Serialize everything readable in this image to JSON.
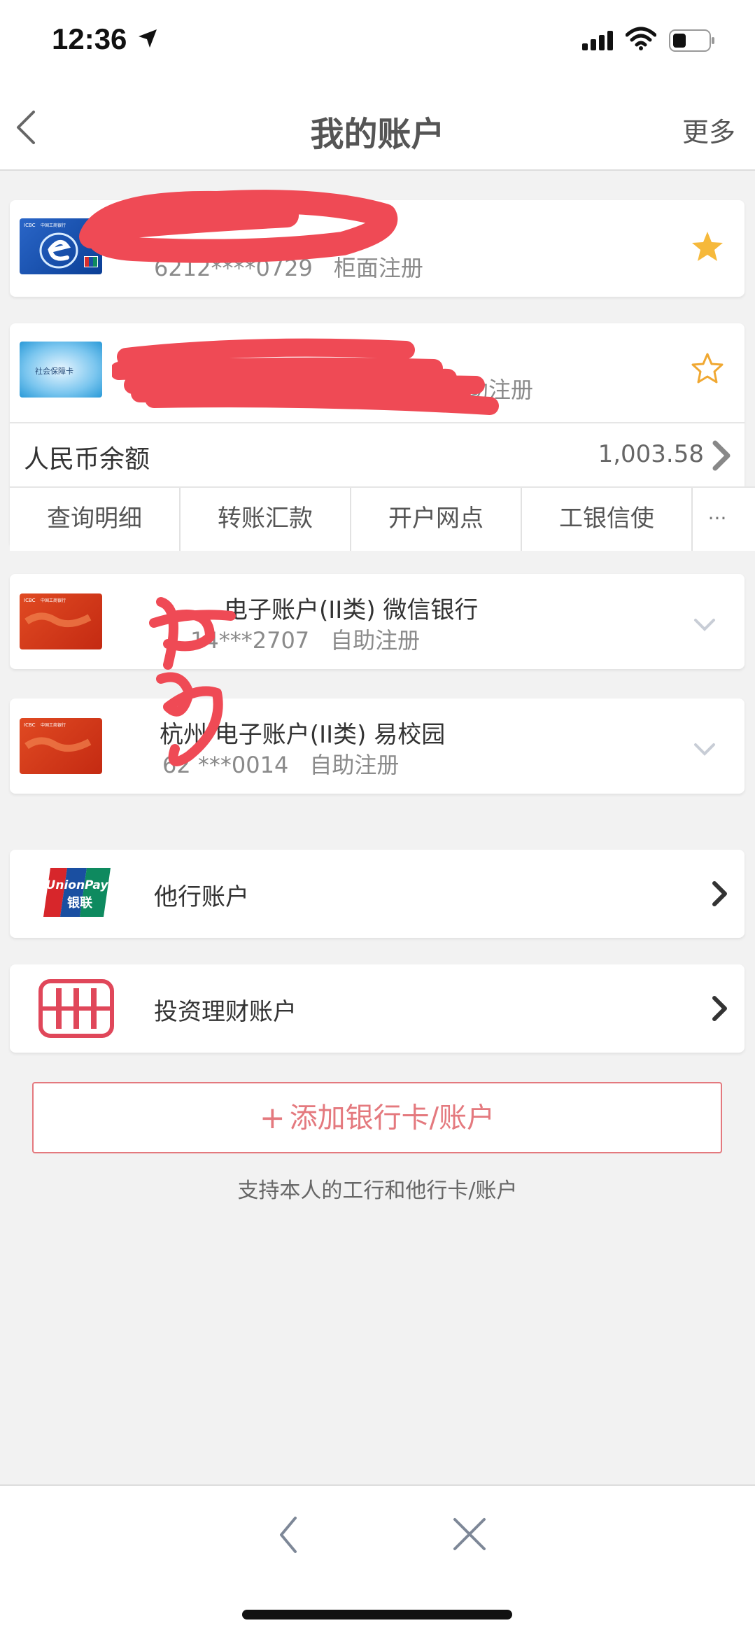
{
  "status_bar": {
    "time": "12:36"
  },
  "nav": {
    "title": "我的账户",
    "more": "更多"
  },
  "cards": [
    {
      "name": "",
      "number": "6212****0729",
      "channel": "柜面注册",
      "starred": true
    },
    {
      "name": "",
      "number": "",
      "channel": "自助注册",
      "starred": false
    },
    {
      "name": "电子账户(II类) 微信银行",
      "number": "14***2707",
      "channel": "自助注册"
    },
    {
      "name": "杭州 电子账户(II类) 易校园",
      "number": "62 ***0014",
      "channel": "自助注册"
    }
  ],
  "balance": {
    "label": "人民币余额",
    "value": "1,003.58"
  },
  "actions": [
    "查询明细",
    "转账汇款",
    "开户网点",
    "工银信使"
  ],
  "actions_more": "···",
  "menu": [
    {
      "label": "他行账户",
      "logo_top": "UnionPay",
      "logo_bottom": "银联"
    },
    {
      "label": "投资理财账户"
    }
  ],
  "add": {
    "plus": "+",
    "label": "添加银行卡/账户",
    "hint": "支持本人的工行和他行卡/账户"
  },
  "card_art": {
    "icbc_text": "中国工商银行",
    "icbc_tag": "ICBC",
    "social_text": "社会保障卡"
  },
  "colors": {
    "accent": "#e4797e",
    "star_active": "#f6b93b",
    "redaction": "#ef4a55"
  }
}
